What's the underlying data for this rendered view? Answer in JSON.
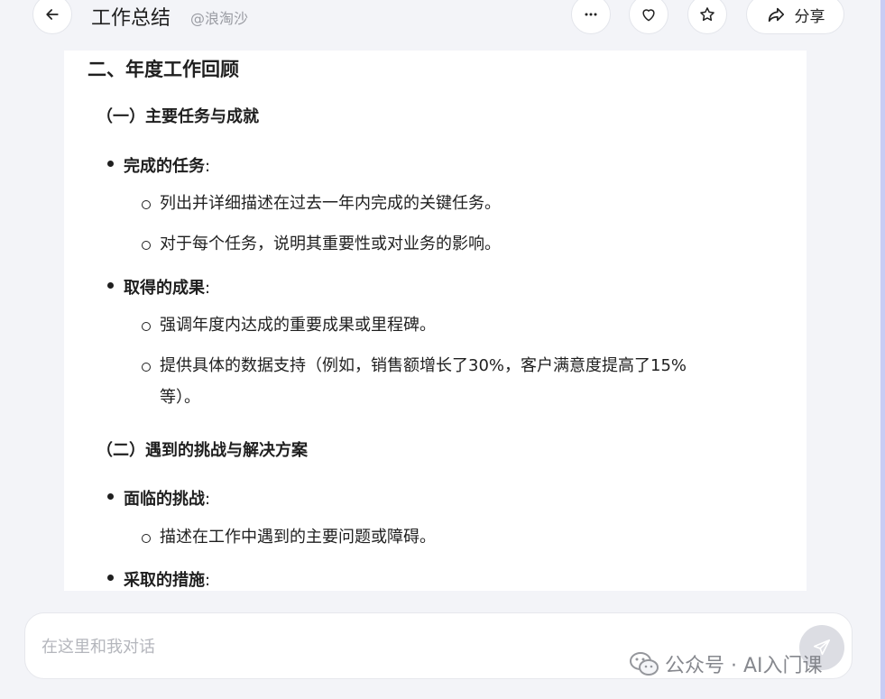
{
  "header": {
    "title": "工作总结",
    "author": "@浪淘沙",
    "share_label": "分享",
    "icons": [
      "arrow-left-icon",
      "more-icon",
      "heart-icon",
      "star-icon",
      "share-icon"
    ]
  },
  "document": {
    "section_title": "二、年度工作回顾",
    "subsections": [
      {
        "title": "（一）主要任务与成就",
        "items": [
          {
            "label": "完成的任务",
            "sub": [
              "列出并详细描述在过去一年内完成的关键任务。",
              "对于每个任务，说明其重要性或对业务的影响。"
            ]
          },
          {
            "label": "取得的成果",
            "sub": [
              "强调年度内达成的重要成果或里程碑。",
              "提供具体的数据支持（例如，销售额增长了30%，客户满意度提高了15%",
              "等）。"
            ]
          }
        ]
      },
      {
        "title": "（二）遇到的挑战与解决方案",
        "items": [
          {
            "label": "面临的挑战",
            "sub": [
              "描述在工作中遇到的主要问题或障碍。"
            ]
          },
          {
            "label": "采取的措施",
            "sub": []
          }
        ]
      }
    ],
    "colon": ":"
  },
  "chat": {
    "placeholder": "在这里和我对话"
  },
  "watermark": {
    "text": "公众号 · AI入门课"
  },
  "colors": {
    "background": "#f3f4f8",
    "panel": "#ffffff",
    "text": "#1f1f1f",
    "muted": "#9a9ca3",
    "accent_edge": "#c9ccf4"
  }
}
